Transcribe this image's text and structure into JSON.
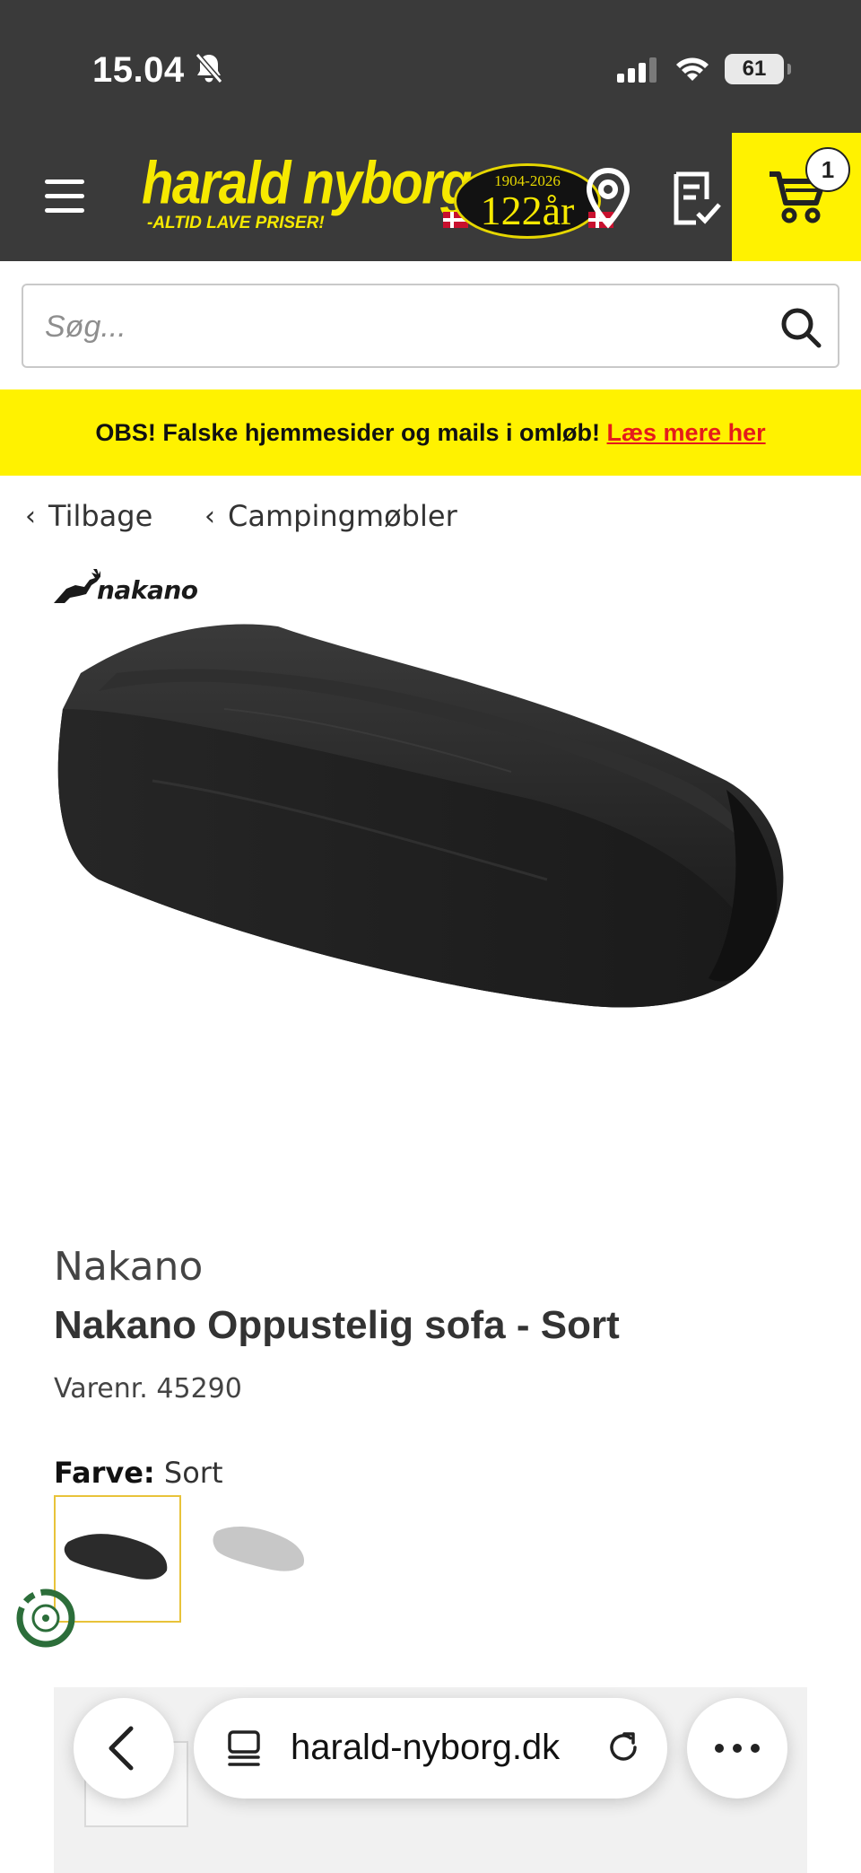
{
  "status_bar": {
    "time": "15.04",
    "battery": "61"
  },
  "header": {
    "logo_name": "harald nyborg",
    "logo_tagline": "-ALTID LAVE PRISER!",
    "anniversary_years": "1904-2026",
    "anniversary_badge": "122år",
    "cart_count": "1"
  },
  "search": {
    "placeholder": "Søg..."
  },
  "notice": {
    "text": "OBS! Falske hjemmesider og mails i omløb! ",
    "link": "Læs mere her"
  },
  "breadcrumbs": {
    "back": "Tilbage",
    "category": "Campingmøbler"
  },
  "product": {
    "brand_logo": "nakano",
    "brand": "Nakano",
    "title": "Nakano Oppustelig sofa - Sort",
    "sku_label": "Varenr.",
    "sku": "45290",
    "color_label": "Farve:",
    "color_value": "Sort",
    "swatches": [
      {
        "name": "Sort",
        "color": "#2b2b2b",
        "selected": true
      },
      {
        "name": "Grå",
        "color": "#c7c7c7",
        "selected": false
      }
    ]
  },
  "browser": {
    "url": "harald-nyborg.dk"
  },
  "colors": {
    "brand_yellow": "#fff200",
    "header_bg": "#3a3a3a",
    "notice_link": "#e41b1b",
    "swatch_border": "#e8c33a"
  }
}
